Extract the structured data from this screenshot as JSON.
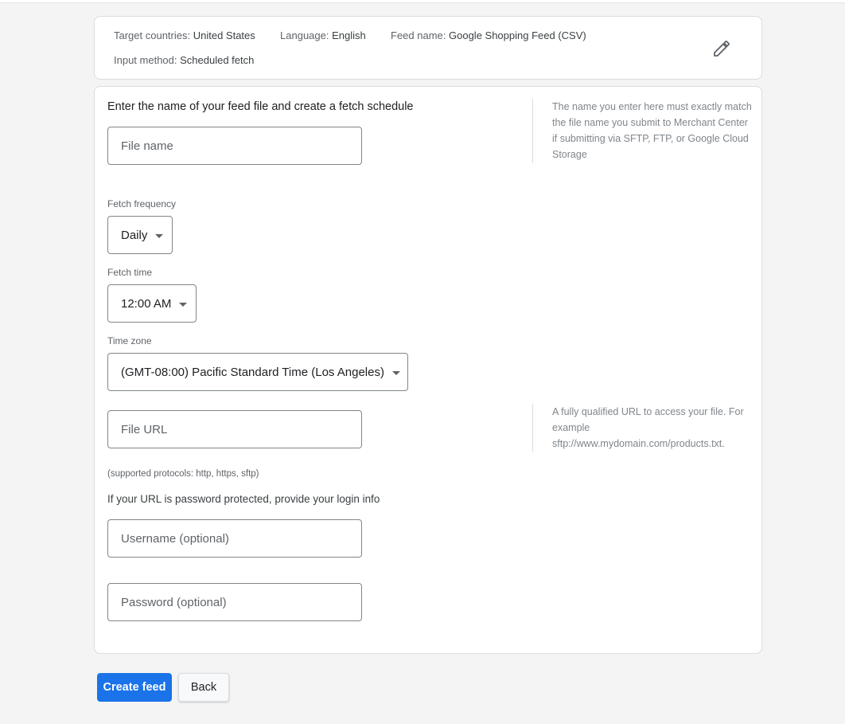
{
  "summary": {
    "target_countries_label": "Target countries:",
    "target_countries_value": "United States",
    "language_label": "Language:",
    "language_value": "English",
    "feed_name_label": "Feed name:",
    "feed_name_value": "Google Shopping Feed (CSV)",
    "input_method_label": "Input method:",
    "input_method_value": "Scheduled fetch",
    "edit_icon": "pencil-icon"
  },
  "form": {
    "heading": "Enter the name of your feed file and create a fetch schedule",
    "file_name_placeholder": "File name",
    "file_name_value": "",
    "file_name_help": "The name you enter here must exactly match the file name you submit to Merchant Center if submitting via SFTP, FTP, or Google Cloud Storage",
    "fetch_frequency_label": "Fetch frequency",
    "fetch_frequency_value": "Daily",
    "fetch_time_label": "Fetch time",
    "fetch_time_value": "12:00 AM",
    "time_zone_label": "Time zone",
    "time_zone_value": "(GMT-08:00) Pacific Standard Time (Los Angeles)",
    "file_url_placeholder": "File URL",
    "file_url_value": "",
    "file_url_help": "A fully qualified URL to access your file. For example sftp://www.mydomain.com/products.txt.",
    "protocols_note": "(supported protocols: http, https, sftp)",
    "login_heading": "If your URL is password protected, provide your login info",
    "username_placeholder": "Username (optional)",
    "username_value": "",
    "password_placeholder": "Password (optional)",
    "password_value": ""
  },
  "actions": {
    "create_label": "Create feed",
    "back_label": "Back"
  },
  "colors": {
    "primary": "#1a73e8",
    "background": "#f4f4f4",
    "border": "#dadce0"
  }
}
